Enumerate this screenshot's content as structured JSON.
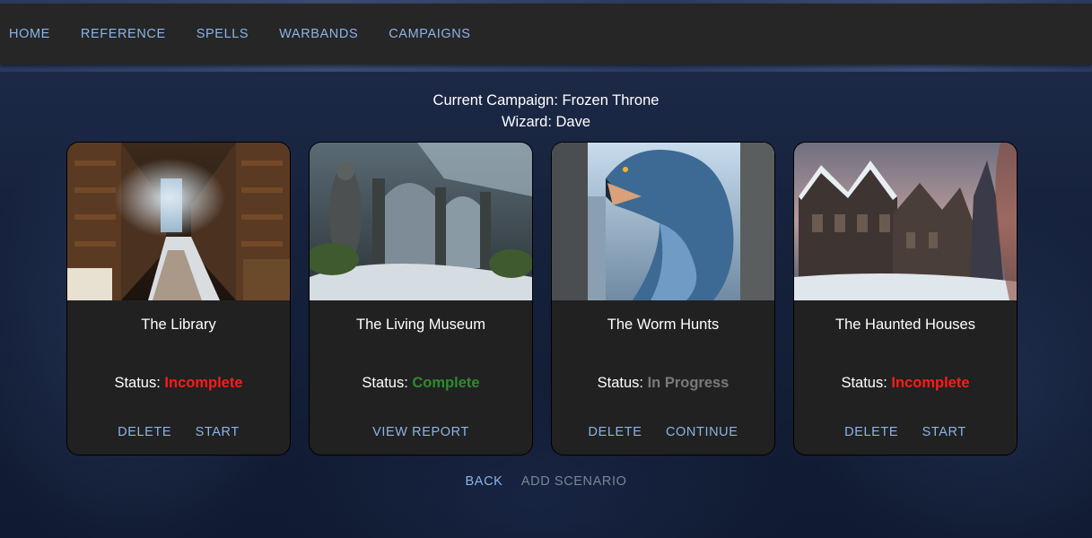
{
  "nav": {
    "items": [
      "HOME",
      "REFERENCE",
      "SPELLS",
      "WARBANDS",
      "CAMPAIGNS"
    ],
    "link_color": "#8ab4e8"
  },
  "campaign": {
    "current_line": "Current Campaign: Frozen Throne",
    "wizard_line": "Wizard: Dave"
  },
  "scenarios": [
    {
      "title": "The Library",
      "status_label": "Status:",
      "status_value": "Incomplete",
      "status_color": "#ff1a1a",
      "image": "snowy-library-illustration",
      "actions": [
        "DELETE",
        "START"
      ]
    },
    {
      "title": "The Living Museum",
      "status_label": "Status:",
      "status_value": "Complete",
      "status_color": "#2e8b2e",
      "image": "ruined-museum-statues-illustration",
      "actions": [
        "VIEW REPORT"
      ]
    },
    {
      "title": "The Worm Hunts",
      "status_label": "Status:",
      "status_value": "In Progress",
      "status_color": "#7a7a7a",
      "image": "frost-worm-monster-illustration",
      "actions": [
        "DELETE",
        "CONTINUE"
      ]
    },
    {
      "title": "The Haunted Houses",
      "status_label": "Status:",
      "status_value": "Incomplete",
      "status_color": "#ff1a1a",
      "image": "snowy-haunted-mansion-illustration",
      "actions": [
        "DELETE",
        "START"
      ]
    }
  ],
  "bottom": {
    "back_label": "BACK",
    "add_label": "ADD SCENARIO"
  }
}
